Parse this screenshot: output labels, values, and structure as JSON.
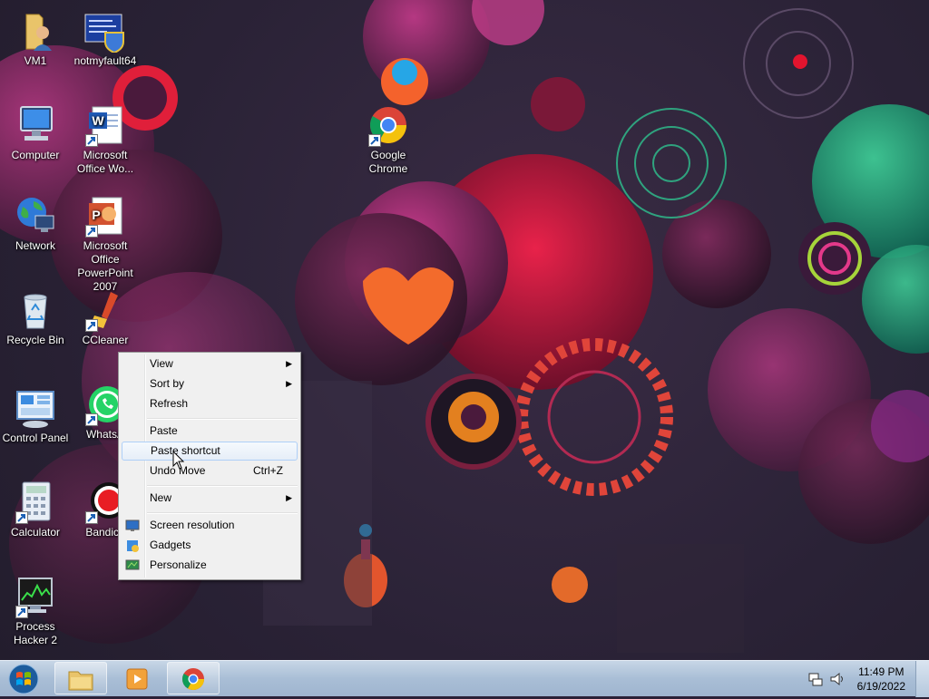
{
  "desktop": {
    "icons": [
      {
        "label": "VM1",
        "icon": "folder-user-icon"
      },
      {
        "label": "notmyfault64",
        "icon": "program-shield-icon"
      },
      {
        "label": "Computer",
        "icon": "computer-icon"
      },
      {
        "label": "Microsoft Office Wo...",
        "icon": "word-icon"
      },
      {
        "label": "Google Chrome",
        "icon": "chrome-icon"
      },
      {
        "label": "Network",
        "icon": "network-icon"
      },
      {
        "label": "Microsoft Office PowerPoint 2007",
        "icon": "powerpoint-icon"
      },
      {
        "label": "Recycle Bin",
        "icon": "recycle-bin-icon"
      },
      {
        "label": "CCleaner",
        "icon": "ccleaner-icon"
      },
      {
        "label": "Control Panel",
        "icon": "control-panel-icon"
      },
      {
        "label": "WhatsA",
        "icon": "whatsapp-icon"
      },
      {
        "label": "Calculator",
        "icon": "calculator-icon"
      },
      {
        "label": "Bandica",
        "icon": "bandicam-icon"
      },
      {
        "label": "Process Hacker 2",
        "icon": "process-hacker-icon"
      }
    ]
  },
  "context_menu": {
    "items": [
      {
        "label": "View",
        "submenu": true
      },
      {
        "label": "Sort by",
        "submenu": true
      },
      {
        "label": "Refresh"
      },
      {
        "label": "Paste"
      },
      {
        "label": "Paste shortcut",
        "highlighted": true
      },
      {
        "label": "Undo Move",
        "shortcut": "Ctrl+Z"
      },
      {
        "label": "New",
        "submenu": true
      },
      {
        "label": "Screen resolution",
        "icon": "monitor-icon"
      },
      {
        "label": "Gadgets",
        "icon": "gadgets-icon"
      },
      {
        "label": "Personalize",
        "icon": "personalize-icon"
      }
    ]
  },
  "taskbar": {
    "pinned": [
      {
        "name": "explorer",
        "icon": "folder-icon"
      },
      {
        "name": "media-player",
        "icon": "media-player-icon"
      },
      {
        "name": "chrome",
        "icon": "chrome-icon"
      }
    ],
    "tray": [
      "network-tray-icon",
      "volume-icon"
    ],
    "clock": {
      "time": "11:49 PM",
      "date": "6/19/2022"
    }
  },
  "colors": {
    "taskbar": "#a9bed6",
    "menu_bg": "#f0f0f0",
    "menu_highlight_border": "#aecff7"
  }
}
